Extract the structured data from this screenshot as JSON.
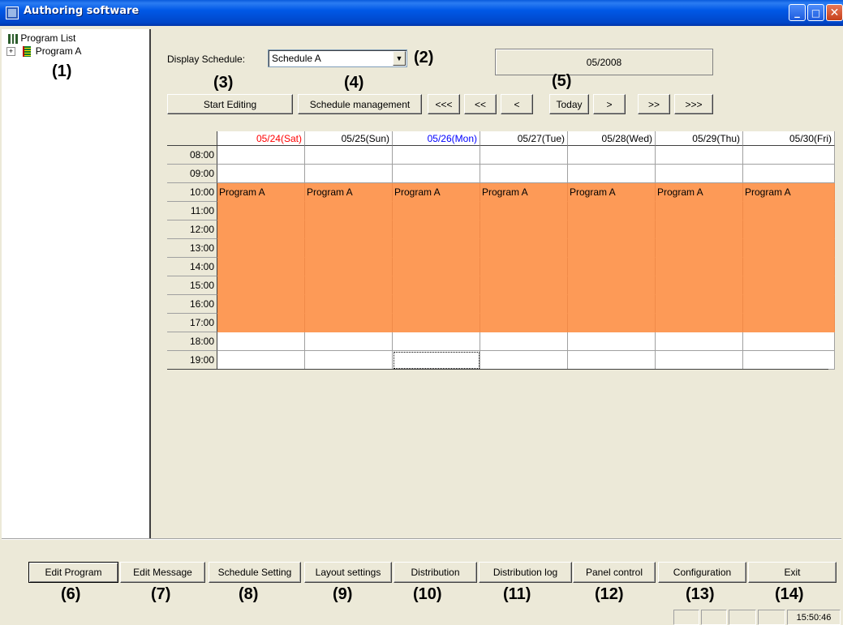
{
  "window": {
    "title": "Authoring software"
  },
  "tree": {
    "root_label": "Program List",
    "items": [
      {
        "label": "Program A",
        "expander": "+"
      }
    ]
  },
  "schedule": {
    "display_label": "Display Schedule:",
    "selected": "Schedule A",
    "month": "05/2008",
    "start_editing": "Start Editing",
    "schedule_management": "Schedule management",
    "nav": [
      "<<<",
      "<<",
      "<",
      "Today",
      ">",
      ">>",
      ">>>"
    ],
    "days": [
      {
        "label": "05/24(Sat)",
        "color": "#ff0000"
      },
      {
        "label": "05/25(Sun)",
        "color": "#000000"
      },
      {
        "label": "05/26(Mon)",
        "color": "#0000ff"
      },
      {
        "label": "05/27(Tue)",
        "color": "#000000"
      },
      {
        "label": "05/28(Wed)",
        "color": "#000000"
      },
      {
        "label": "05/29(Thu)",
        "color": "#000000"
      },
      {
        "label": "05/30(Fri)",
        "color": "#000000"
      }
    ],
    "times": [
      "08:00",
      "09:00",
      "10:00",
      "11:00",
      "12:00",
      "13:00",
      "14:00",
      "15:00",
      "16:00",
      "17:00",
      "18:00",
      "19:00"
    ],
    "program": {
      "name": "Program A",
      "start": "10:00",
      "end": "18:00",
      "color": "#fd9a57"
    }
  },
  "callouts": [
    "(1)",
    "(2)",
    "(3)",
    "(4)",
    "(5)",
    "(6)",
    "(7)",
    "(8)",
    "(9)",
    "(10)",
    "(11)",
    "(12)",
    "(13)",
    "(14)"
  ],
  "bottom_buttons": [
    "Edit Program",
    "Edit Message",
    "Schedule Setting",
    "Layout settings",
    "Distribution",
    "Distribution log",
    "Panel control",
    "Configuration",
    "Exit"
  ],
  "status": {
    "clock": "15:50:46"
  }
}
